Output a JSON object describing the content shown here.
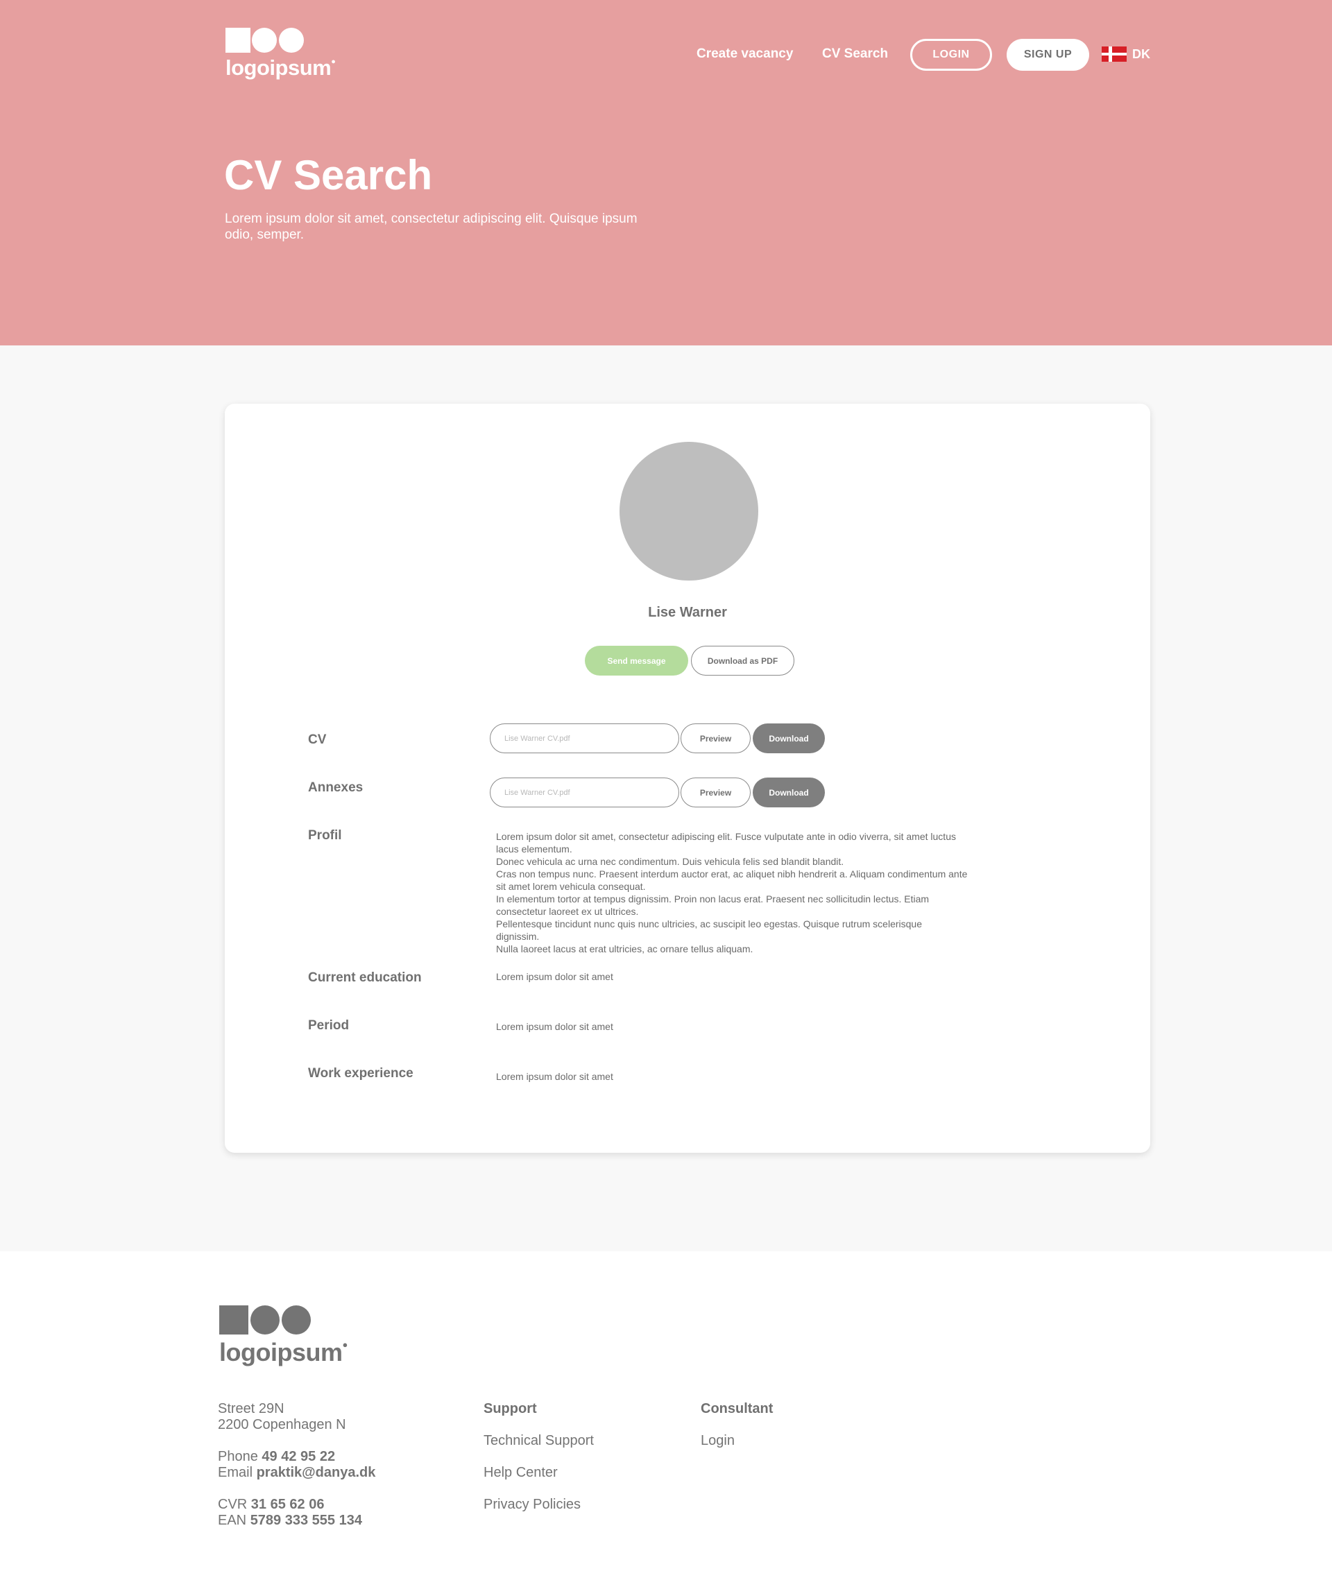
{
  "header": {
    "logo_text": "logoipsum",
    "nav": {
      "create_vacancy": "Create vacancy",
      "cv_search": "CV Search"
    },
    "login_label": "LOGIN",
    "signup_label": "SIGN UP",
    "language": "DK"
  },
  "hero": {
    "title": "CV Search",
    "subtitle": "Lorem ipsum dolor sit amet, consectetur adipiscing elit. Quisque ipsum odio, semper."
  },
  "profile": {
    "name": "Lise Warner",
    "send_message_label": "Send message",
    "download_pdf_label": "Download as PDF",
    "rows": {
      "cv": {
        "label": "CV",
        "file_placeholder": "Lise Warner CV.pdf",
        "preview_label": "Preview",
        "download_label": "Download"
      },
      "annexes": {
        "label": "Annexes",
        "file_placeholder": "Lise Warner CV.pdf",
        "preview_label": "Preview",
        "download_label": "Download"
      },
      "profil": {
        "label": "Profil",
        "paragraphs": [
          "Lorem ipsum dolor sit amet, consectetur adipiscing elit. Fusce vulputate ante in odio viverra, sit amet luctus lacus elementum.",
          "Donec vehicula ac urna nec condimentum. Duis vehicula felis sed blandit blandit.",
          "Cras non tempus nunc. Praesent interdum auctor erat, ac aliquet nibh hendrerit a. Aliquam condimentum ante sit amet lorem vehicula consequat.",
          "In elementum tortor at tempus dignissim. Proin non lacus erat. Praesent nec sollicitudin lectus. Etiam consectetur laoreet ex ut ultrices.",
          "Pellentesque tincidunt nunc quis nunc ultricies, ac suscipit leo egestas. Quisque rutrum scelerisque dignissim.",
          "Nulla laoreet lacus at erat ultricies, ac ornare tellus aliquam."
        ]
      },
      "current_education": {
        "label": "Current education",
        "value": "Lorem ipsum dolor sit amet"
      },
      "period": {
        "label": "Period",
        "value": "Lorem ipsum dolor sit amet"
      },
      "work_experience": {
        "label": "Work experience",
        "value": "Lorem ipsum dolor sit amet"
      }
    }
  },
  "footer": {
    "logo_text": "logoipsum",
    "address": {
      "street": "Street 29N",
      "city": "2200 Copenhagen N",
      "phone_label": "Phone",
      "phone": "49 42 95 22",
      "email_label": "Email",
      "email": "praktik@danya.dk",
      "cvr_label": "CVR",
      "cvr": "31 65 62 06",
      "ean_label": "EAN",
      "ean": "5789 333 555 134"
    },
    "support": {
      "heading": "Support",
      "links": [
        "Technical Support",
        "Help Center",
        "Privacy Policies"
      ]
    },
    "consultant": {
      "heading": "Consultant",
      "links": [
        "Login"
      ]
    }
  },
  "colors": {
    "hero_bg": "#e69f9f",
    "page_bg": "#f8f8f8",
    "send_button": "#b4dc9c",
    "download_button": "#7f7f7f",
    "text_gray": "#707070"
  }
}
